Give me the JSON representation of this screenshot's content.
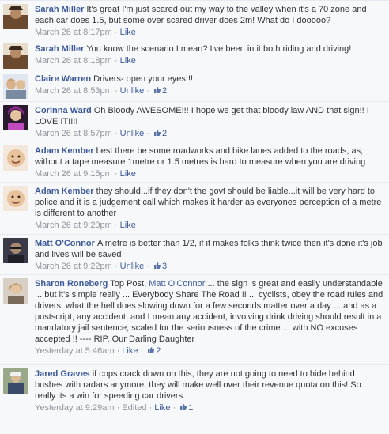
{
  "comments": [
    {
      "author": "Sarah Miller",
      "text": "It's great I'm just scared out my way to the valley when it's a 70 zone and each car does 1.5, but some over scared driver does 2m! What do I dooooo?",
      "time": "March 26 at 8:17pm",
      "action": "Like",
      "avatar_color": "#8a6a4a"
    },
    {
      "author": "Sarah Miller",
      "text": "You know the scenario I mean? I've been in it both riding and driving!",
      "time": "March 26 at 8:18pm",
      "action": "Like",
      "avatar_color": "#8a6a4a"
    },
    {
      "author": "Claire Warren",
      "text": "Drivers- open your eyes!!!",
      "time": "March 26 at 8:53pm",
      "action": "Unlike",
      "likes": "2",
      "avatar_color": "#c9a27a"
    },
    {
      "author": "Corinna Ward",
      "text": "Oh Bloody AWESOME!!! I hope we get that bloody law AND that sign!! I LOVE IT!!!!",
      "time": "March 26 at 8:57pm",
      "action": "Unlike",
      "likes": "2",
      "avatar_color": "#7a3f8a"
    },
    {
      "author": "Adam Kember",
      "text": "best there be some roadworks and bike lanes added to the roads, as, without a tape measure 1metre or 1.5 metres is hard to measure when you are driving",
      "time": "March 26 at 9:15pm",
      "action": "Like",
      "avatar_color": "#d9b48c"
    },
    {
      "author": "Adam Kember",
      "text": "they should...if they don't the govt should be liable...it will be very hard to police and it is a judgement call which makes it harder as everyones perception of a metre is different to another",
      "time": "March 26 at 9:20pm",
      "action": "Like",
      "avatar_color": "#d9b48c"
    },
    {
      "author": "Matt O'Connor",
      "text": "A metre is better than 1/2, if it makes folks think twice then it's done it's job and lives will be saved",
      "time": "March 26 at 9:22pm",
      "action": "Unlike",
      "likes": "3",
      "avatar_color": "#4a4a5a"
    },
    {
      "author": "Sharon Roneberg",
      "text_before": "Top Post,",
      "mention": "Matt O'Connor",
      "text_after": "... the sign is great and easily understandable ... but it's simple really ... Everybody Share The Road !! ... cyclists, obey the road rules and drivers, what the hell does slowing down for a few seconds matter over a day ... and as a postscript, any accident, and I mean any accident, involving drink driving should result in a mandatory jail sentence, scaled for the seriousness of the crime ... with NO excuses accepted !! ---- RIP, Our Darling Daughter",
      "time": "Yesterday at 5:46am",
      "action": "Like",
      "likes": "2",
      "avatar_color": "#b8a48a"
    },
    {
      "author": "Jared Graves",
      "text": "if cops crack down on this, they are not going to need to hide behind bushes with radars anymore, they will make well over their revenue quota on this! So really its a win for speeding car drivers.",
      "time": "Yesterday at 9:29am",
      "edited": "Edited",
      "action": "Like",
      "likes": "1",
      "avatar_color": "#6a7a5a"
    }
  ],
  "separator": "·"
}
